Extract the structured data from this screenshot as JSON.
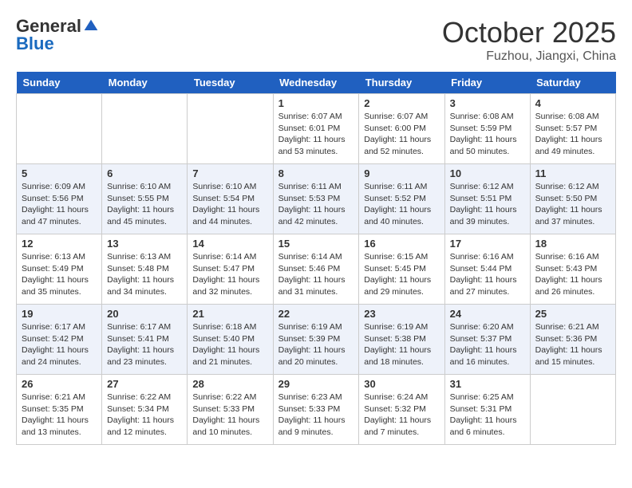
{
  "header": {
    "logo_general": "General",
    "logo_blue": "Blue",
    "month": "October 2025",
    "location": "Fuzhou, Jiangxi, China"
  },
  "weekdays": [
    "Sunday",
    "Monday",
    "Tuesday",
    "Wednesday",
    "Thursday",
    "Friday",
    "Saturday"
  ],
  "weeks": [
    [
      {
        "day": "",
        "info": ""
      },
      {
        "day": "",
        "info": ""
      },
      {
        "day": "",
        "info": ""
      },
      {
        "day": "1",
        "info": "Sunrise: 6:07 AM\nSunset: 6:01 PM\nDaylight: 11 hours\nand 53 minutes."
      },
      {
        "day": "2",
        "info": "Sunrise: 6:07 AM\nSunset: 6:00 PM\nDaylight: 11 hours\nand 52 minutes."
      },
      {
        "day": "3",
        "info": "Sunrise: 6:08 AM\nSunset: 5:59 PM\nDaylight: 11 hours\nand 50 minutes."
      },
      {
        "day": "4",
        "info": "Sunrise: 6:08 AM\nSunset: 5:57 PM\nDaylight: 11 hours\nand 49 minutes."
      }
    ],
    [
      {
        "day": "5",
        "info": "Sunrise: 6:09 AM\nSunset: 5:56 PM\nDaylight: 11 hours\nand 47 minutes."
      },
      {
        "day": "6",
        "info": "Sunrise: 6:10 AM\nSunset: 5:55 PM\nDaylight: 11 hours\nand 45 minutes."
      },
      {
        "day": "7",
        "info": "Sunrise: 6:10 AM\nSunset: 5:54 PM\nDaylight: 11 hours\nand 44 minutes."
      },
      {
        "day": "8",
        "info": "Sunrise: 6:11 AM\nSunset: 5:53 PM\nDaylight: 11 hours\nand 42 minutes."
      },
      {
        "day": "9",
        "info": "Sunrise: 6:11 AM\nSunset: 5:52 PM\nDaylight: 11 hours\nand 40 minutes."
      },
      {
        "day": "10",
        "info": "Sunrise: 6:12 AM\nSunset: 5:51 PM\nDaylight: 11 hours\nand 39 minutes."
      },
      {
        "day": "11",
        "info": "Sunrise: 6:12 AM\nSunset: 5:50 PM\nDaylight: 11 hours\nand 37 minutes."
      }
    ],
    [
      {
        "day": "12",
        "info": "Sunrise: 6:13 AM\nSunset: 5:49 PM\nDaylight: 11 hours\nand 35 minutes."
      },
      {
        "day": "13",
        "info": "Sunrise: 6:13 AM\nSunset: 5:48 PM\nDaylight: 11 hours\nand 34 minutes."
      },
      {
        "day": "14",
        "info": "Sunrise: 6:14 AM\nSunset: 5:47 PM\nDaylight: 11 hours\nand 32 minutes."
      },
      {
        "day": "15",
        "info": "Sunrise: 6:14 AM\nSunset: 5:46 PM\nDaylight: 11 hours\nand 31 minutes."
      },
      {
        "day": "16",
        "info": "Sunrise: 6:15 AM\nSunset: 5:45 PM\nDaylight: 11 hours\nand 29 minutes."
      },
      {
        "day": "17",
        "info": "Sunrise: 6:16 AM\nSunset: 5:44 PM\nDaylight: 11 hours\nand 27 minutes."
      },
      {
        "day": "18",
        "info": "Sunrise: 6:16 AM\nSunset: 5:43 PM\nDaylight: 11 hours\nand 26 minutes."
      }
    ],
    [
      {
        "day": "19",
        "info": "Sunrise: 6:17 AM\nSunset: 5:42 PM\nDaylight: 11 hours\nand 24 minutes."
      },
      {
        "day": "20",
        "info": "Sunrise: 6:17 AM\nSunset: 5:41 PM\nDaylight: 11 hours\nand 23 minutes."
      },
      {
        "day": "21",
        "info": "Sunrise: 6:18 AM\nSunset: 5:40 PM\nDaylight: 11 hours\nand 21 minutes."
      },
      {
        "day": "22",
        "info": "Sunrise: 6:19 AM\nSunset: 5:39 PM\nDaylight: 11 hours\nand 20 minutes."
      },
      {
        "day": "23",
        "info": "Sunrise: 6:19 AM\nSunset: 5:38 PM\nDaylight: 11 hours\nand 18 minutes."
      },
      {
        "day": "24",
        "info": "Sunrise: 6:20 AM\nSunset: 5:37 PM\nDaylight: 11 hours\nand 16 minutes."
      },
      {
        "day": "25",
        "info": "Sunrise: 6:21 AM\nSunset: 5:36 PM\nDaylight: 11 hours\nand 15 minutes."
      }
    ],
    [
      {
        "day": "26",
        "info": "Sunrise: 6:21 AM\nSunset: 5:35 PM\nDaylight: 11 hours\nand 13 minutes."
      },
      {
        "day": "27",
        "info": "Sunrise: 6:22 AM\nSunset: 5:34 PM\nDaylight: 11 hours\nand 12 minutes."
      },
      {
        "day": "28",
        "info": "Sunrise: 6:22 AM\nSunset: 5:33 PM\nDaylight: 11 hours\nand 10 minutes."
      },
      {
        "day": "29",
        "info": "Sunrise: 6:23 AM\nSunset: 5:33 PM\nDaylight: 11 hours\nand 9 minutes."
      },
      {
        "day": "30",
        "info": "Sunrise: 6:24 AM\nSunset: 5:32 PM\nDaylight: 11 hours\nand 7 minutes."
      },
      {
        "day": "31",
        "info": "Sunrise: 6:25 AM\nSunset: 5:31 PM\nDaylight: 11 hours\nand 6 minutes."
      },
      {
        "day": "",
        "info": ""
      }
    ]
  ]
}
